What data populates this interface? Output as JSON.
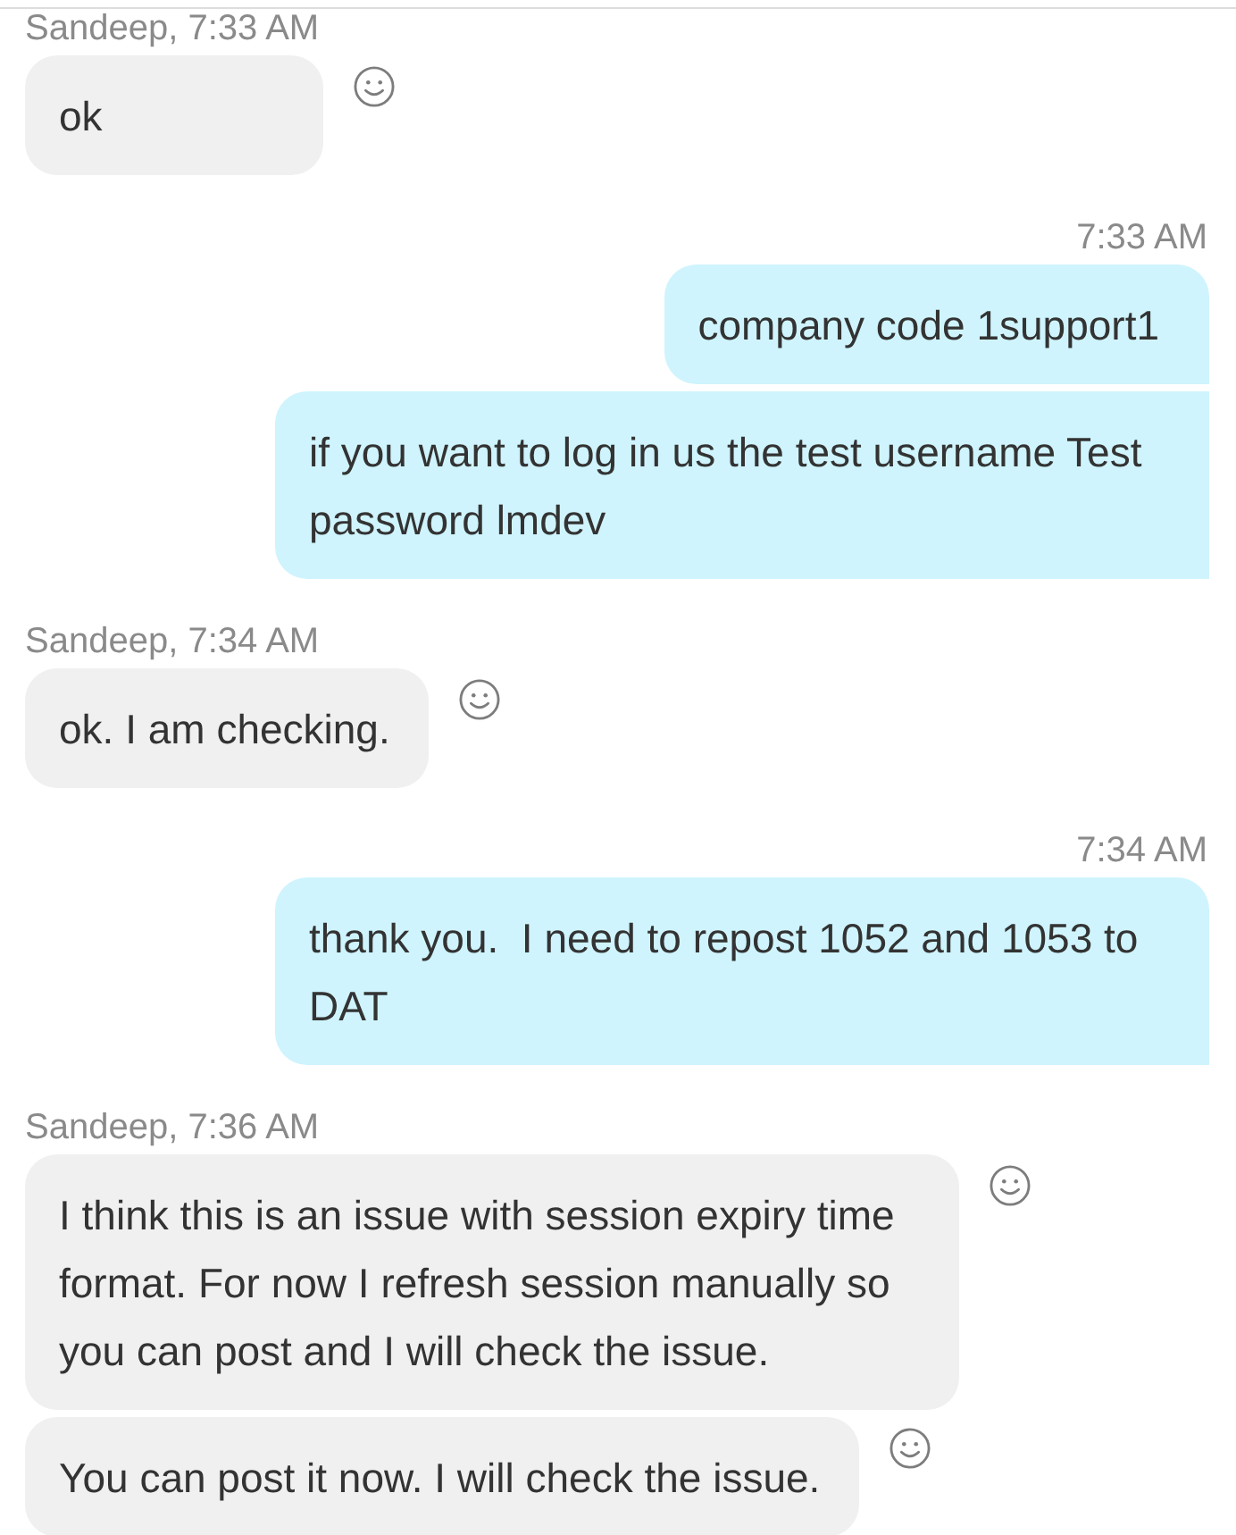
{
  "messages": [
    {
      "kind": "incoming",
      "header": "Sandeep, 7:33 AM",
      "bubbles": [
        {
          "text": "ok"
        }
      ]
    },
    {
      "kind": "outgoing",
      "header": "7:33 AM",
      "bubbles": [
        {
          "text": "company code 1support1"
        },
        {
          "text": "if you want to log in us the test username Test password lmdev"
        }
      ]
    },
    {
      "kind": "incoming",
      "header": "Sandeep, 7:34 AM",
      "bubbles": [
        {
          "text": "ok. I am checking."
        }
      ]
    },
    {
      "kind": "outgoing",
      "header": "7:34 AM",
      "bubbles": [
        {
          "text": "thank you.  I need to repost 1052 and 1053 to DAT"
        }
      ]
    },
    {
      "kind": "incoming",
      "header": "Sandeep, 7:36 AM",
      "bubbles": [
        {
          "text": "I think this is an issue with session expiry time format. For now I refresh session manually so you can post and I will check the issue."
        },
        {
          "text": "You can post it now. I will check the issue."
        }
      ]
    }
  ]
}
